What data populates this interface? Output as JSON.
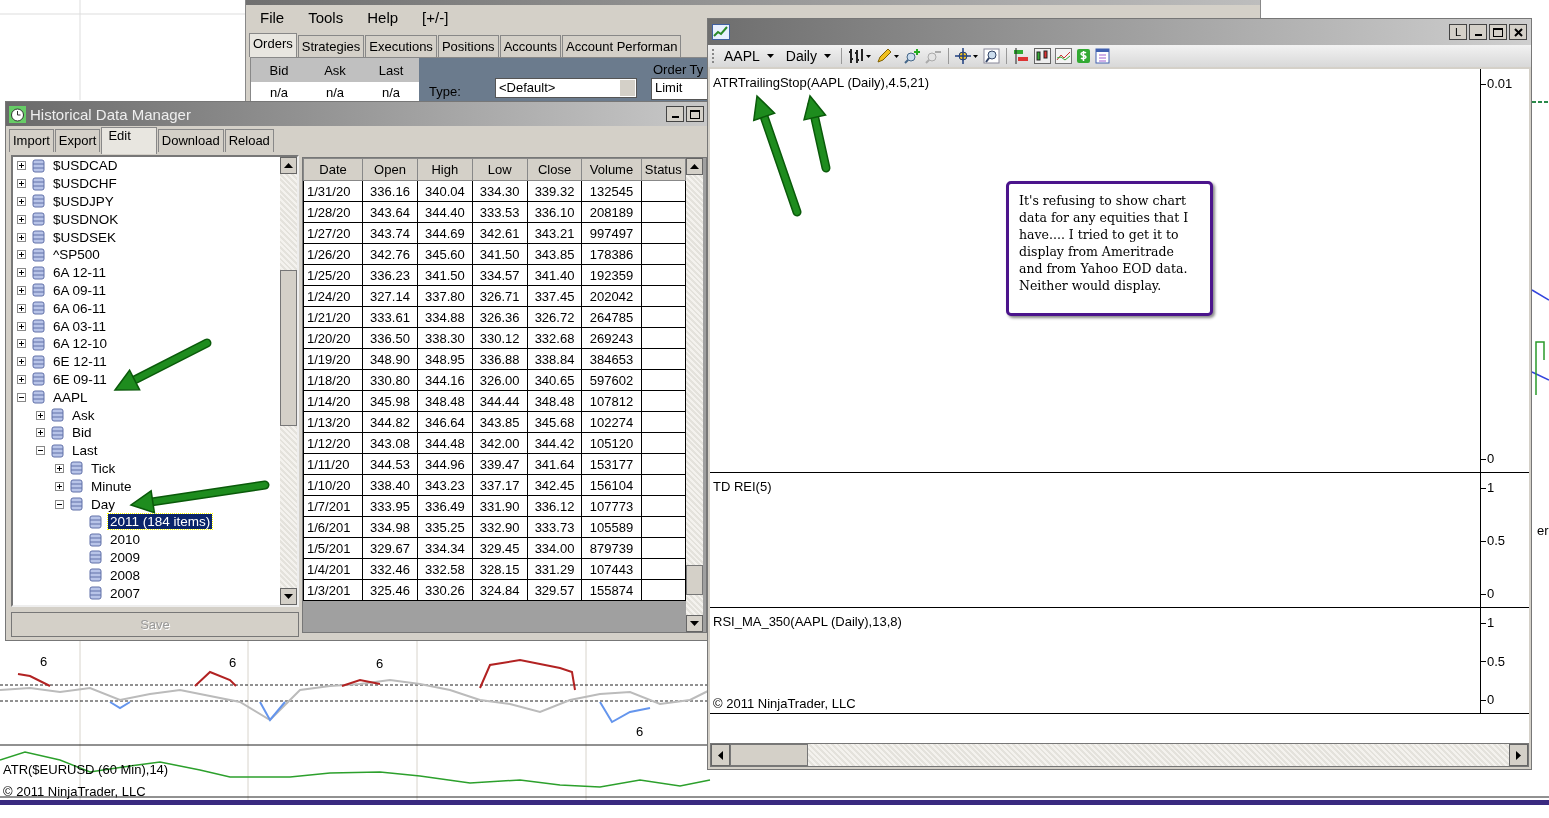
{
  "background_chart": {
    "bar_labels": [
      "6",
      "6",
      "6",
      "6"
    ],
    "indicator_label": "ATR($EURUSD (60 Min),14)",
    "copyright": "© 2011 NinjaTrader, LLC",
    "right_fragment": "er"
  },
  "control_center": {
    "menu": [
      "File",
      "Tools",
      "Help",
      "[+/-]"
    ],
    "tabs": [
      {
        "label": "Orders",
        "selected": true
      },
      {
        "label": "Strategies",
        "selected": false
      },
      {
        "label": "Executions",
        "selected": false
      },
      {
        "label": "Positions",
        "selected": false
      },
      {
        "label": "Accounts",
        "selected": false
      },
      {
        "label": "Account Performan",
        "selected": false
      }
    ],
    "quote_columns": [
      "Bid",
      "Ask",
      "Last"
    ],
    "quote_values": [
      "n/a",
      "n/a",
      "n/a"
    ],
    "order_panel_title": "Order Ty",
    "type_label": "Type:",
    "type_value": "<Default>",
    "order_type_value": "Limit"
  },
  "history_manager": {
    "title": "Historical Data Manager",
    "tabs": [
      {
        "label": "Import",
        "selected": false
      },
      {
        "label": "Export",
        "selected": false
      },
      {
        "label": "Edit",
        "selected": true
      },
      {
        "label": "Download",
        "selected": false
      },
      {
        "label": "Reload",
        "selected": false
      }
    ],
    "tree": [
      {
        "label": "$USDCAD",
        "expanded": false,
        "selected": false
      },
      {
        "label": "$USDCHF",
        "expanded": false,
        "selected": false
      },
      {
        "label": "$USDJPY",
        "expanded": false,
        "selected": false
      },
      {
        "label": "$USDNOK",
        "expanded": false,
        "selected": false
      },
      {
        "label": "$USDSEK",
        "expanded": false,
        "selected": false
      },
      {
        "label": "^SP500",
        "expanded": false,
        "selected": false
      },
      {
        "label": "6A 12-11",
        "expanded": false,
        "selected": false
      },
      {
        "label": "6A 09-11",
        "expanded": false,
        "selected": false
      },
      {
        "label": "6A 06-11",
        "expanded": false,
        "selected": false
      },
      {
        "label": "6A 03-11",
        "expanded": false,
        "selected": false
      },
      {
        "label": "6A 12-10",
        "expanded": false,
        "selected": false
      },
      {
        "label": "6E 12-11",
        "expanded": false,
        "selected": false
      },
      {
        "label": "6E 09-11",
        "expanded": false,
        "selected": false
      },
      {
        "label": "AAPL",
        "expanded": true,
        "selected": false,
        "children": [
          {
            "label": "Ask",
            "expanded": false,
            "selected": false
          },
          {
            "label": "Bid",
            "expanded": false,
            "selected": false
          },
          {
            "label": "Last",
            "expanded": true,
            "selected": false,
            "children": [
              {
                "label": "Tick",
                "expanded": false,
                "selected": false
              },
              {
                "label": "Minute",
                "expanded": false,
                "selected": false
              },
              {
                "label": "Day",
                "expanded": true,
                "selected": false,
                "children": [
                  {
                    "label": "2011 (184 items)",
                    "selected": true
                  },
                  {
                    "label": "2010",
                    "selected": false
                  },
                  {
                    "label": "2009",
                    "selected": false
                  },
                  {
                    "label": "2008",
                    "selected": false
                  },
                  {
                    "label": "2007",
                    "selected": false
                  }
                ]
              }
            ]
          }
        ]
      }
    ],
    "columns": [
      "Date",
      "Open",
      "High",
      "Low",
      "Close",
      "Volume",
      "Status"
    ],
    "rows": [
      [
        "1/31/20",
        "336.16",
        "340.04",
        "334.30",
        "339.32",
        "132545"
      ],
      [
        "1/28/20",
        "343.64",
        "344.40",
        "333.53",
        "336.10",
        "208189"
      ],
      [
        "1/27/20",
        "343.74",
        "344.69",
        "342.61",
        "343.21",
        "997497"
      ],
      [
        "1/26/20",
        "342.76",
        "345.60",
        "341.50",
        "343.85",
        "178386"
      ],
      [
        "1/25/20",
        "336.23",
        "341.50",
        "334.57",
        "341.40",
        "192359"
      ],
      [
        "1/24/20",
        "327.14",
        "337.80",
        "326.71",
        "337.45",
        "202042"
      ],
      [
        "1/21/20",
        "333.61",
        "334.88",
        "326.36",
        "326.72",
        "264785"
      ],
      [
        "1/20/20",
        "336.50",
        "338.30",
        "330.12",
        "332.68",
        "269243"
      ],
      [
        "1/19/20",
        "348.90",
        "348.95",
        "336.88",
        "338.84",
        "384653"
      ],
      [
        "1/18/20",
        "330.80",
        "344.16",
        "326.00",
        "340.65",
        "597602"
      ],
      [
        "1/14/20",
        "345.98",
        "348.48",
        "344.44",
        "348.48",
        "107812"
      ],
      [
        "1/13/20",
        "344.82",
        "346.64",
        "343.85",
        "345.68",
        "102274"
      ],
      [
        "1/12/20",
        "343.08",
        "344.48",
        "342.00",
        "344.42",
        "105120"
      ],
      [
        "1/11/20",
        "344.53",
        "344.96",
        "339.47",
        "341.64",
        "153177"
      ],
      [
        "1/10/20",
        "338.40",
        "343.23",
        "337.17",
        "342.45",
        "156104"
      ],
      [
        "1/7/201",
        "333.95",
        "336.49",
        "331.90",
        "336.12",
        "107773"
      ],
      [
        "1/6/201",
        "334.98",
        "335.25",
        "332.90",
        "333.73",
        "105589"
      ],
      [
        "1/5/201",
        "329.67",
        "334.34",
        "329.45",
        "334.00",
        "879739"
      ],
      [
        "1/4/201",
        "332.46",
        "332.58",
        "328.15",
        "331.29",
        "107443"
      ],
      [
        "1/3/201",
        "325.46",
        "330.26",
        "324.84",
        "329.57",
        "155874"
      ]
    ],
    "save_button": {
      "label": "Save",
      "disabled": true
    }
  },
  "chart_window": {
    "title_button": "L",
    "instrument": "AAPL",
    "period": "Daily",
    "panels": [
      {
        "label": "ATRTrailingStop(AAPL (Daily),4.5,21)",
        "ticks": [
          "0.01",
          "0"
        ]
      },
      {
        "label": "TD REI(5)",
        "ticks": [
          "1",
          "0.5",
          "0"
        ]
      },
      {
        "label": "RSI_MA_350(AAPL (Daily),13,8)",
        "ticks": [
          "1",
          "0.5",
          "0"
        ],
        "copyright": "© 2011 NinjaTrader, LLC"
      }
    ]
  },
  "callout": {
    "text": "It's refusing to show chart data for any equities that I have.... I tried to get it to display from Ameritrade and from Yahoo EOD data. Neither would display."
  }
}
